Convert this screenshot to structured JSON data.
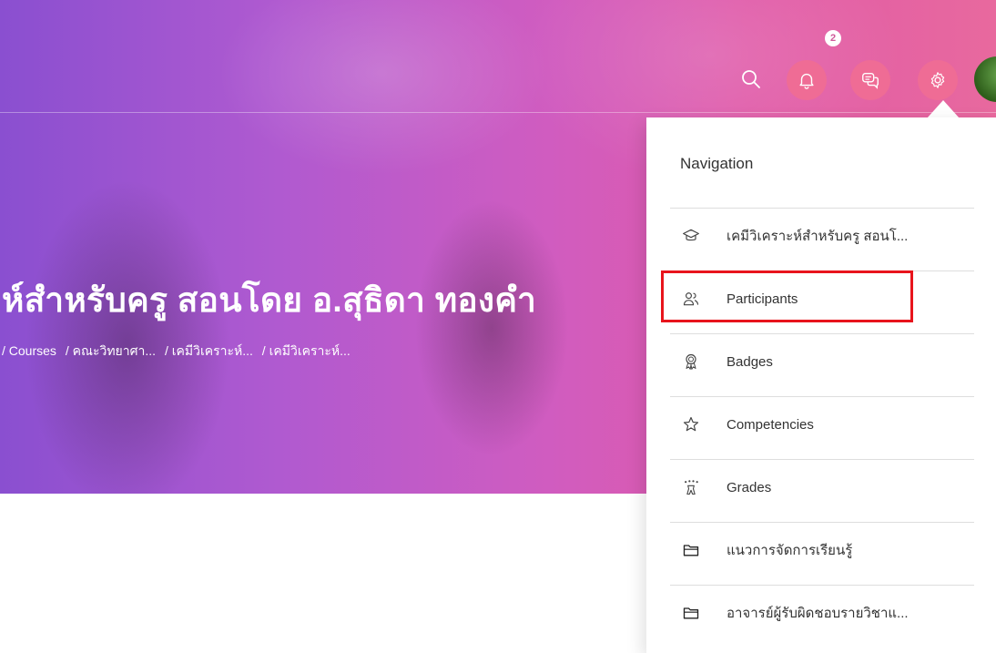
{
  "hero": {
    "title": "ห์สำหรับครู สอนโดย อ.สุธิดา ทองคำ",
    "breadcrumb": [
      "/ Courses",
      "/ คณะวิทยาศา...",
      "/ เคมีวิเคราะห์...",
      "/ เคมีวิเคราะห์..."
    ]
  },
  "topbar": {
    "icons": [
      "search-icon",
      "bell-icon",
      "chat-icon",
      "gear-icon"
    ],
    "notification_count": "2",
    "accent": "#ef6c95"
  },
  "navigation": {
    "header": "Navigation",
    "items": [
      {
        "label": "เคมีวิเคราะห์สำหรับครู สอนโ...",
        "icon": "graduation-cap-icon"
      },
      {
        "label": "Participants",
        "icon": "participants-icon"
      },
      {
        "label": "Badges",
        "icon": "badge-icon"
      },
      {
        "label": "Competencies",
        "icon": "star-icon"
      },
      {
        "label": "Grades",
        "icon": "grades-icon"
      },
      {
        "label": "แนวการจัดการเรียนรู้",
        "icon": "folder-icon"
      },
      {
        "label": "อาจารย์ผู้รับผิดชอบรายวิชาแ...",
        "icon": "folder-icon"
      }
    ],
    "highlight_color": "#e8141c"
  }
}
